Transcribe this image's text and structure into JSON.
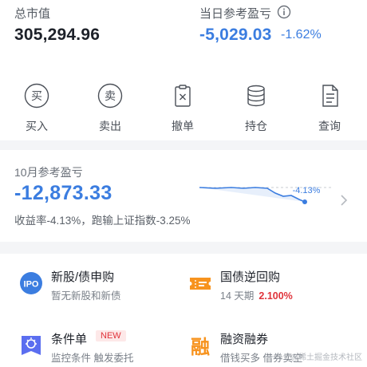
{
  "summary": {
    "market_value_label": "总市值",
    "market_value": "305,294.96",
    "daily_pnl_label": "当日参考盈亏",
    "daily_pnl": "-5,029.03",
    "daily_pnl_pct": "-1.62%"
  },
  "actions": [
    {
      "label": "买入",
      "icon_char": "买"
    },
    {
      "label": "卖出",
      "icon_char": "卖"
    },
    {
      "label": "撤单"
    },
    {
      "label": "持仓"
    },
    {
      "label": "查询"
    }
  ],
  "monthly": {
    "label": "10月参考盈亏",
    "value": "-12,873.33",
    "subtitle": "收益率-4.13%，跑输上证指数-3.25%",
    "spark_label": "-4.13%"
  },
  "services": [
    {
      "name": "新股/债申购",
      "desc": "暂无新股和新债",
      "icon_text": "IPO"
    },
    {
      "name": "国债逆回购",
      "desc": "14 天期",
      "rate": "2.100%"
    },
    {
      "name": "条件单",
      "badge": "NEW",
      "desc": "监控条件 触发委托"
    },
    {
      "name": "融资融券",
      "desc": "借钱买多 借券卖空",
      "icon_text": "融"
    }
  ],
  "watermark": "@稀土掘金技术社区",
  "colors": {
    "accent_blue": "#3b7de0",
    "loss_red": "#e0333b",
    "orange": "#f7931e"
  }
}
